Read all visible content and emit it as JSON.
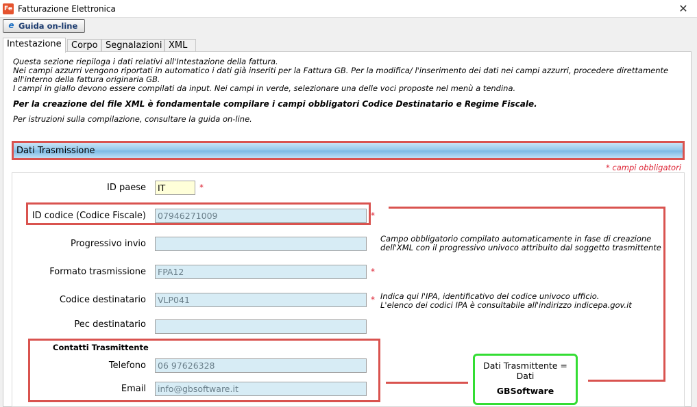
{
  "window": {
    "title": "Fatturazione Elettronica",
    "icon_text": "Fe",
    "close_glyph": "✕"
  },
  "toolbar": {
    "guide_label": "Guida on-line",
    "guide_icon": "e"
  },
  "tabs": [
    {
      "label": "Intestazione",
      "active": true
    },
    {
      "label": "Corpo",
      "active": false
    },
    {
      "label": "Segnalazioni",
      "active": false
    },
    {
      "label": "XML",
      "active": false
    }
  ],
  "info": {
    "line1": "Questa sezione riepiloga i dati relativi all'Intestazione della fattura.",
    "line2": "Nei campi azzurri vengono riportati in automatico i dati già inseriti per la Fattura GB. Per la modifica/ l'inserimento dei dati nei campi azzurri, procedere direttamente",
    "line3": "all'interno della fattura originaria GB.",
    "line4": "I campi in giallo devono essere compilati da input. Nei campi in verde, selezionare una delle voci proposte nel menù a tendina.",
    "bold": "Per la creazione del file XML è fondamentale compilare i campi obbligatori Codice Destinatario e Regime Fiscale.",
    "guide_text": "Per istruzioni sulla compilazione, consultare la guida on-line."
  },
  "section": {
    "title": "Dati Trasmissione",
    "required_note": "* campi obbligatori"
  },
  "form": {
    "id_paese": {
      "label": "ID paese",
      "value": "IT",
      "required": "*"
    },
    "id_codice": {
      "label": "ID codice (Codice Fiscale)",
      "value": "07946271009",
      "required": "*"
    },
    "progressivo": {
      "label": "Progressivo invio",
      "value": ""
    },
    "formato": {
      "label": "Formato trasmissione",
      "value": "FPA12",
      "required": "*"
    },
    "codice_dest": {
      "label": "Codice destinatario",
      "value": "VLP041",
      "required": "*"
    },
    "pec": {
      "label": "Pec destinatario",
      "value": ""
    },
    "contatti_title": "Contatti Trasmittente",
    "telefono": {
      "label": "Telefono",
      "value": "06 97626328"
    },
    "email": {
      "label": "Email",
      "value": "info@gbsoftware.it"
    }
  },
  "notes": {
    "progressivo_1": "Campo obbligatorio compilato automaticamente in fase di creazione",
    "progressivo_2": "dell'XML con il progressivo univoco attribuito dal soggetto trasmittente",
    "ipa_1": "Indica qui l'IPA, identificativo del codice univoco ufficio.",
    "ipa_2": "L'elenco dei codici IPA è consultabile all'indirizzo indicepa.gov.it"
  },
  "callout": {
    "line1": "Dati Trasmittente =",
    "line2": "Dati",
    "line3": "GBSoftware"
  },
  "colors": {
    "annotation_red": "#d9534f",
    "annotation_green": "#33dd33",
    "field_blue": "#d7ecf5",
    "field_yellow": "#ffffd9"
  }
}
